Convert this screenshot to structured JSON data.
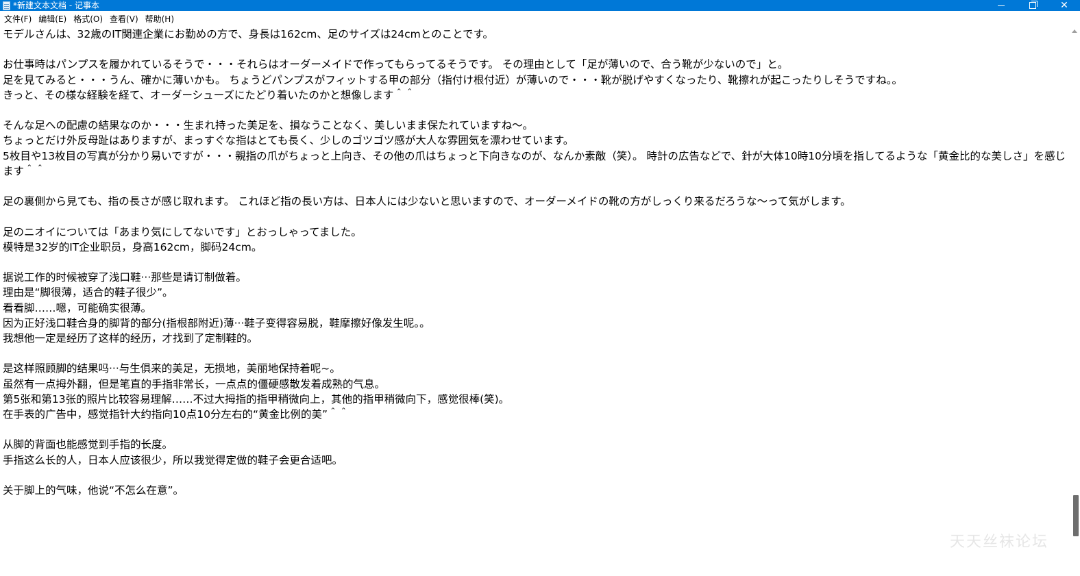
{
  "window": {
    "title": "*新建文本文档 - 记事本",
    "minimize_icon": "minimize-icon",
    "maximize_icon": "restore-icon",
    "close_glyph": "✕"
  },
  "menu": {
    "items": [
      {
        "label": "文件(F)"
      },
      {
        "label": "编辑(E)"
      },
      {
        "label": "格式(O)"
      },
      {
        "label": "查看(V)"
      },
      {
        "label": "帮助(H)"
      }
    ]
  },
  "editor": {
    "lines": [
      "モデルさんは、32歳のIT関連企業にお勤めの方で、身長は162cm、足のサイズは24cmとのことです。",
      "",
      "お仕事時はパンプスを履かれているそうで・・・それらはオーダーメイドで作ってもらってるそうです。 その理由として「足が薄いので、合う靴が少ないので」と。",
      "足を見てみると・・・うん、確かに薄いかも。 ちょうどパンプスがフィットする甲の部分（指付け根付近）が薄いので・・・靴が脱げやすくなったり、靴擦れが起こったりしそうですね。。",
      "きっと、その様な経験を経て、オーダーシューズにたどり着いたのかと想像します＾＾",
      "",
      "そんな足への配慮の結果なのか・・・生まれ持った美足を、損なうことなく、美しいまま保たれていますね～。",
      "ちょっとだけ外反母趾はありますが、まっすぐな指はとても長く、少しのゴツゴツ感が大人な雰囲気を漂わせています。",
      "5枚目や13枚目の写真が分かり易いですが・・・親指の爪がちょっと上向き、その他の爪はちょっと下向きなのが、なんか素敵（笑）。 時計の広告などで、針が大体10時10分頃を指してるような「黄金比的な美しさ」を感じます＾＾",
      "",
      "足の裏側から見ても、指の長さが感じ取れます。 これほど指の長い方は、日本人には少ないと思いますので、オーダーメイドの靴の方がしっくり来るだろうな～って気がします。",
      "",
      "足のニオイについては「あまり気にしてないです」とおっしゃってました。",
      "模特是32岁的IT企业职员，身高162cm，脚码24cm。",
      "",
      "据说工作的时候被穿了浅口鞋···那些是请订制做着。",
      "理由是“脚很薄，适合的鞋子很少”。",
      "看看脚……嗯，可能确实很薄。",
      "因为正好浅口鞋合身的脚背的部分(指根部附近)薄···鞋子变得容易脱，鞋摩擦好像发生呢。。",
      "我想他一定是经历了这样的经历，才找到了定制鞋的。",
      "",
      "是这样照顾脚的结果吗···与生俱来的美足，无损地，美丽地保持着呢~。",
      "虽然有一点拇外翻，但是笔直的手指非常长，一点点的僵硬感散发着成熟的气息。",
      "第5张和第13张的照片比较容易理解……不过大拇指的指甲稍微向上，其他的指甲稍微向下，感觉很棒(笑)。",
      "在手表的广告中，感觉指针大约指向10点10分左右的“黄金比例的美”＾＾",
      "",
      "从脚的背面也能感觉到手指的长度。",
      "手指这么长的人，日本人应该很少，所以我觉得定做的鞋子会更合适吧。",
      "",
      "关于脚上的气味，他说“不怎么在意”。"
    ]
  },
  "watermark": {
    "text": "天天丝袜论坛"
  },
  "colors": {
    "titlebar": "#0078d7",
    "text": "#000000",
    "scroll_thumb": "#6e6e6e"
  }
}
